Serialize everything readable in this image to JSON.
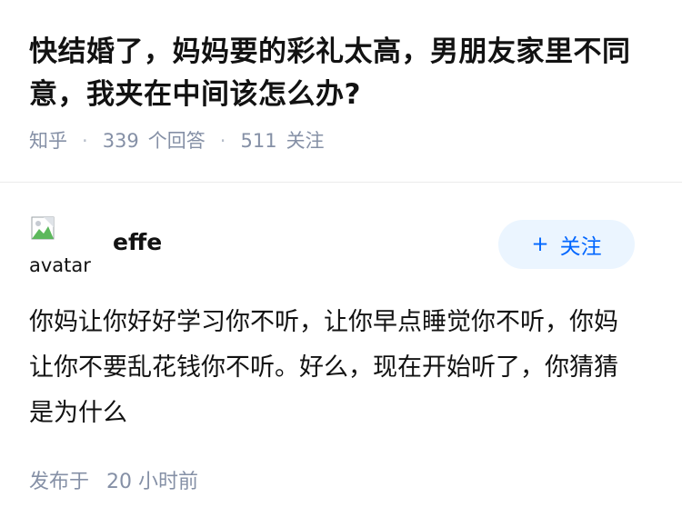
{
  "question": {
    "title": "快结婚了，妈妈要的彩礼太高，男朋友家里不同意，我夹在中间该怎么办?",
    "source": "知乎",
    "answer_count": "339",
    "answer_label": "个回答",
    "follower_count": "511",
    "follower_label": "关注"
  },
  "answer": {
    "avatar_alt": "avatar",
    "author_name": "effe",
    "follow_button": {
      "icon": "+",
      "label": "关注"
    },
    "content": "你妈让你好好学习你不听，让你早点睡觉你不听，你妈让你不要乱花钱你不听。好么，现在开始听了，你猜猜是为什么",
    "published_label": "发布于",
    "published_time": "20 小时前"
  },
  "colors": {
    "text_primary": "#121212",
    "text_secondary": "#8590a6",
    "accent": "#0066ff",
    "follow_button_bg": "#ebf5ff",
    "divider": "#ebebeb"
  }
}
